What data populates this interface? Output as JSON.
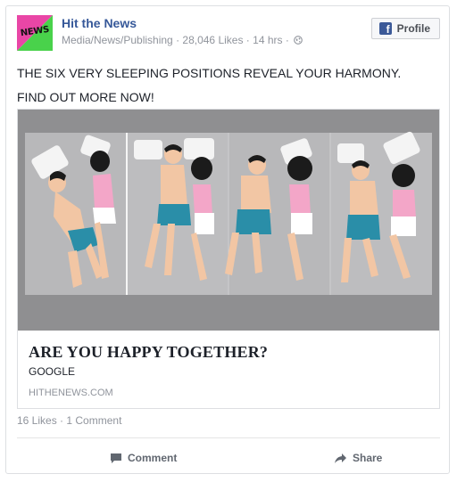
{
  "page": {
    "name": "Hit the News",
    "category": "Media/News/Publishing",
    "likes": "28,046 Likes",
    "time": "14 hrs",
    "separator": " · ",
    "logo_text": "NEWS",
    "logo_colors": {
      "pink": "#e946a6",
      "green": "#49d24b"
    }
  },
  "profile_button": {
    "label": "Profile",
    "icon": "facebook-icon"
  },
  "post": {
    "line1": "THE SIX VERY SLEEPING POSITIONS REVEAL YOUR HARMONY.",
    "line2": "FIND OUT MORE NOW!"
  },
  "link": {
    "image_alt": "illustration of couples in sleeping positions",
    "title": "ARE YOU HAPPY TOGETHER?",
    "description": "GOOGLE",
    "domain": "HITHENEWS.COM"
  },
  "stats": {
    "likes": "16 Likes",
    "comments": "1 Comment"
  },
  "actions": {
    "comment_label": "Comment",
    "share_label": "Share"
  },
  "colors": {
    "link_blue": "#365899",
    "meta_gray": "#90949c",
    "image_bg": "#8f8f91",
    "shorts": "#2a8ea8",
    "pink_top": "#f3a6c8",
    "skin": "#f2c6a4",
    "hair": "#1b1b1b"
  }
}
